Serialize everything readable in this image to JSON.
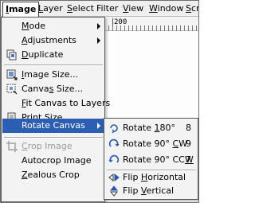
{
  "menubar": {
    "items": [
      {
        "label": "Image",
        "u": "I",
        "rest": "mage"
      },
      {
        "label": "Layer",
        "u": "L",
        "rest": "ayer"
      },
      {
        "label": "Select",
        "u": "S",
        "rest": "elect"
      },
      {
        "label": "Filter",
        "u": "",
        "rest": "Filter"
      },
      {
        "label": "View",
        "u": "V",
        "rest": "iew"
      },
      {
        "label": "Window",
        "u": "W",
        "rest": "indow"
      },
      {
        "label": "Scr",
        "u": "S",
        "rest": "cr"
      }
    ]
  },
  "ruler": {
    "label": "200"
  },
  "image_menu": {
    "mode": {
      "u": "M",
      "rest": "ode"
    },
    "adjustments": {
      "u": "A",
      "rest": "djustments"
    },
    "duplicate": {
      "u": "D",
      "rest": "uplicate"
    },
    "image_size": {
      "u": "I",
      "rest": "mage Size..."
    },
    "canvas_size": {
      "pre": "Canva",
      "u": "s",
      "rest": " Size..."
    },
    "fit_canvas": {
      "u": "F",
      "rest": "it Canvas to Layers"
    },
    "print_size": {
      "u": "P",
      "rest": "rint Size..."
    },
    "rotate_canvas": {
      "label": "Rotate Canvas"
    },
    "crop_image": {
      "u": "C",
      "rest": "rop Image"
    },
    "autocrop": {
      "label": "Autocrop Image"
    },
    "zealous_crop": {
      "u": "Z",
      "rest": "ealous Crop"
    }
  },
  "rotate_submenu": {
    "rotate_180": {
      "pre": "Rotate ",
      "u": "1",
      "rest": "80°",
      "key": "8"
    },
    "rotate_90cw": {
      "pre": "Rotate 90° ",
      "u": "C",
      "rest": "W",
      "key": "9"
    },
    "rotate_90ccw": {
      "pre": "Rotate 90° CC",
      "u": "W",
      "rest": "",
      "key": "7"
    },
    "flip_horizontal": {
      "pre": "Flip ",
      "u": "H",
      "rest": "orizontal"
    },
    "flip_vertical": {
      "pre": "Flip ",
      "u": "V",
      "rest": "ertical"
    }
  },
  "colors": {
    "highlight": "#2c5fb4",
    "menu_bg": "#f3f3f3",
    "disabled": "#9a9a9a"
  }
}
